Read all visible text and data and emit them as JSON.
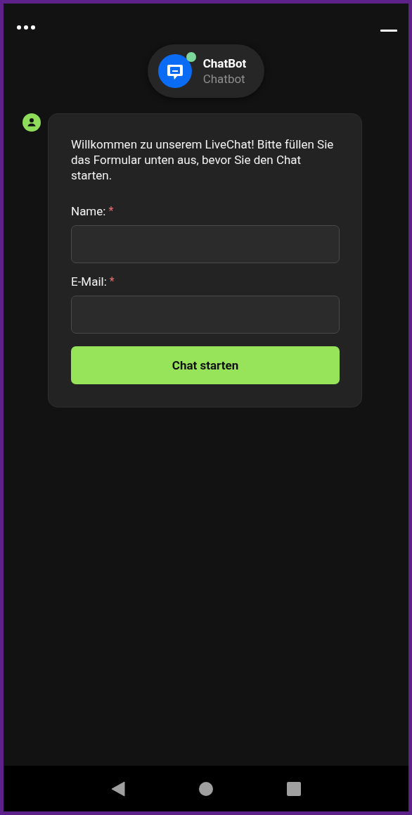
{
  "header": {
    "name": "ChatBot",
    "subtitle": "Chatbot",
    "online": true
  },
  "message": {
    "text": "Willkommen zu unserem LiveChat! Bitte füllen Sie das Formular unten aus, bevor Sie den Chat starten."
  },
  "form": {
    "fields": [
      {
        "label": "Name:",
        "required_mark": "*"
      },
      {
        "label": "E-Mail:",
        "required_mark": "*"
      }
    ],
    "submit": "Chat starten"
  }
}
